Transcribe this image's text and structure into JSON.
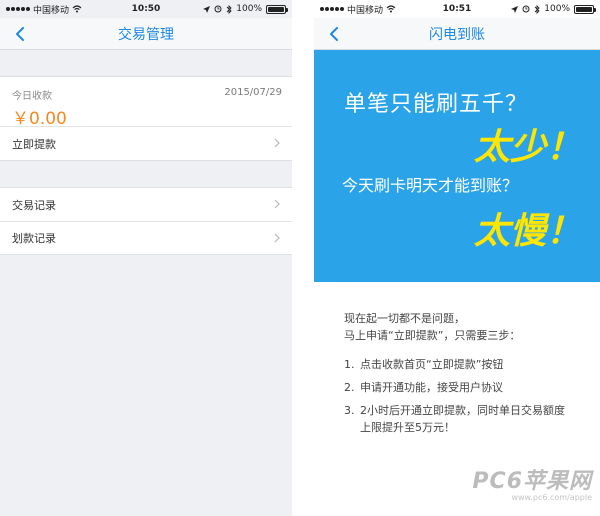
{
  "left": {
    "status": {
      "carrier": "中国移动",
      "time": "10:50",
      "battery": "100%",
      "battery_level": 1.0
    },
    "nav": {
      "title": "交易管理"
    },
    "income": {
      "label": "今日收款",
      "date": "2015/07/29",
      "amount": "￥0.00"
    },
    "rows_top": [
      {
        "label": "立即提款"
      }
    ],
    "rows_bottom": [
      {
        "label": "交易记录"
      },
      {
        "label": "划款记录"
      }
    ]
  },
  "right": {
    "status": {
      "carrier": "中国移动",
      "time": "10:51",
      "battery": "100%",
      "battery_level": 1.0
    },
    "nav": {
      "title": "闪电到账"
    },
    "promo": {
      "line1": "单笔只能刷五千？",
      "big1": "太少！",
      "line2": "今天刷卡明天才能到账？",
      "big2": "太慢！"
    },
    "description": {
      "line1": "现在起一切都不是问题，",
      "line2": "马上申请“立即提款”，只需要三步："
    },
    "steps": [
      {
        "num": "1.",
        "text": "点击收款首页“立即提款”按钮"
      },
      {
        "num": "2.",
        "text": "申请开通功能，接受用户协议"
      },
      {
        "num": "3.",
        "text": "2小时后开通立即提款，同时单日交易额度上限提升至5万元！"
      }
    ]
  },
  "watermark": {
    "big": "PC6苹果网",
    "small": "www.pc6.com/apple"
  },
  "colors": {
    "accent": "#1e88e5",
    "amount": "#f5891f",
    "promo_bg": "#2ba3e8",
    "promo_highlight": "#ffe600"
  }
}
